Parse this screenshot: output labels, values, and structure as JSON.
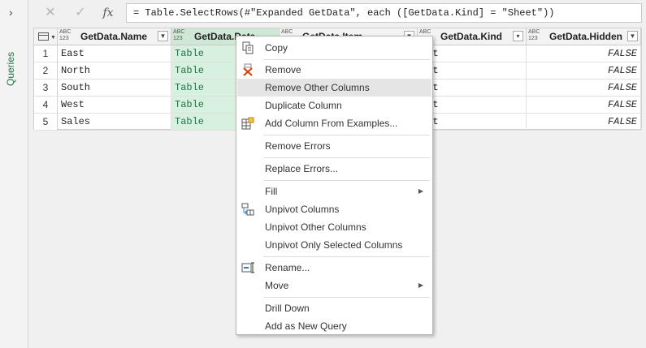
{
  "rail": {
    "label": "Queries"
  },
  "formula_bar": {
    "cancel_icon": "x",
    "ok_icon": "check",
    "fx_label": "fx",
    "formula": "= Table.SelectRows(#\"Expanded GetData\", each ([GetData.Kind] = \"Sheet\"))"
  },
  "columns": [
    {
      "type": "ABC\n123",
      "name": "GetData.Name"
    },
    {
      "type": "ABC\n123",
      "name": "GetData.Data"
    },
    {
      "type": "ABC\n123",
      "name": "GetData.Item"
    },
    {
      "type": "ABC\n123",
      "name": "GetData.Kind"
    },
    {
      "type": "ABC\n123",
      "name": "GetData.Hidden"
    }
  ],
  "rows": [
    {
      "n": "1",
      "name": "East",
      "data": "Table",
      "kind": "eet",
      "hidden": "FALSE"
    },
    {
      "n": "2",
      "name": "North",
      "data": "Table",
      "kind": "eet",
      "hidden": "FALSE"
    },
    {
      "n": "3",
      "name": "South",
      "data": "Table",
      "kind": "eet",
      "hidden": "FALSE"
    },
    {
      "n": "4",
      "name": "West",
      "data": "Table",
      "kind": "eet",
      "hidden": "FALSE"
    },
    {
      "n": "5",
      "name": "Sales",
      "data": "Table",
      "kind": "eet",
      "hidden": "FALSE"
    }
  ],
  "menu": {
    "copy": "Copy",
    "remove": "Remove",
    "remove_other": "Remove Other Columns",
    "duplicate": "Duplicate Column",
    "add_from_examples": "Add Column From Examples...",
    "remove_errors": "Remove Errors",
    "replace_errors": "Replace Errors...",
    "fill": "Fill",
    "unpivot": "Unpivot Columns",
    "unpivot_other": "Unpivot Other Columns",
    "unpivot_selected": "Unpivot Only Selected Columns",
    "rename": "Rename...",
    "move": "Move",
    "drill_down": "Drill Down",
    "add_as_query": "Add as New Query"
  },
  "colors": {
    "accent": "#217346",
    "selected_col": "#d8f0df",
    "menu_highlight": "#e5e5e5"
  }
}
